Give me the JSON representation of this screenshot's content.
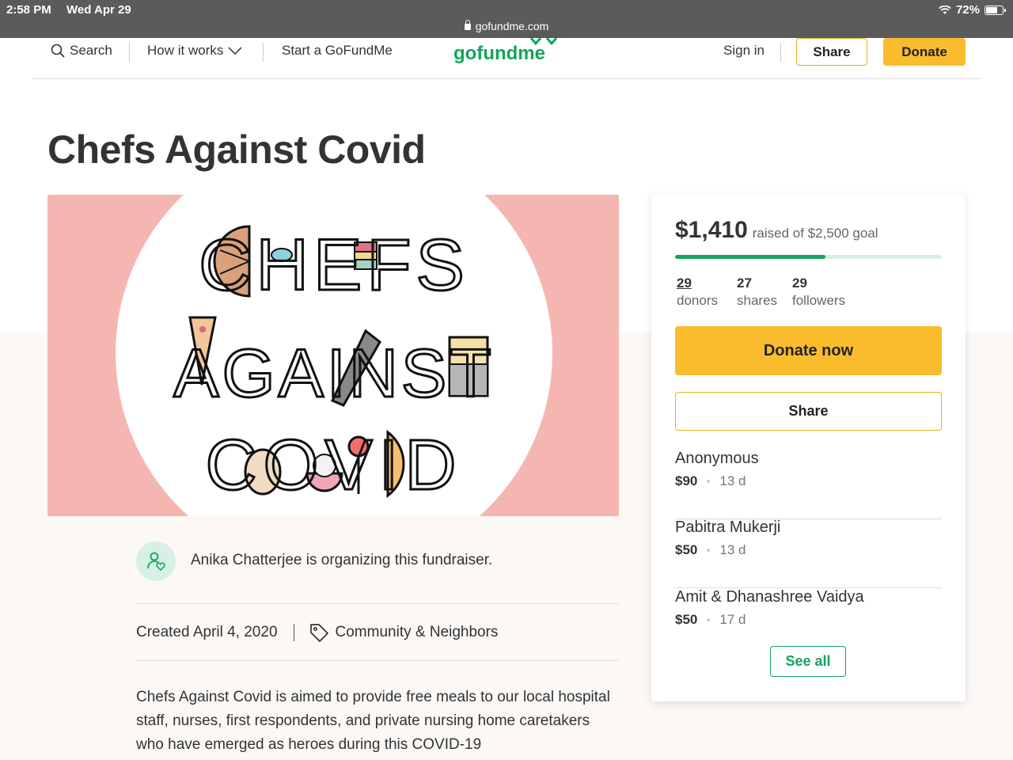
{
  "status_bar": {
    "time": "2:58 PM",
    "date": "Wed Apr 29",
    "url": "gofundme.com",
    "battery": "72%"
  },
  "nav": {
    "search": "Search",
    "how_it_works": "How it works",
    "start": "Start a GoFundMe",
    "logo": "gofundme",
    "sign_in": "Sign in",
    "share": "Share",
    "donate": "Donate"
  },
  "campaign": {
    "title": "Chefs Against Covid",
    "hero_text": [
      "CHEFS",
      "AGAINST",
      "COVID"
    ],
    "organizer": "Anika Chatterjee is organizing this fundraiser.",
    "created": "Created April 4, 2020",
    "category": "Community & Neighbors",
    "story": "Chefs Against Covid is aimed to provide free meals to our local hospital staff, nurses, first respondents, and private nursing home caretakers who have emerged as heroes during this COVID-19"
  },
  "card": {
    "raised_amount": "$1,410",
    "raised_label": "raised of $2,500 goal",
    "progress": 0.564,
    "stats": [
      {
        "num": "29",
        "label": "donors"
      },
      {
        "num": "27",
        "label": "shares"
      },
      {
        "num": "29",
        "label": "followers"
      }
    ],
    "donate_now": "Donate now",
    "share": "Share",
    "donors": [
      {
        "name": "Anonymous",
        "amount": "$90",
        "age": "13 d"
      },
      {
        "name": "Pabitra Mukerji",
        "amount": "$50",
        "age": "13 d"
      },
      {
        "name": "Amit & Dhanashree Vaidya",
        "amount": "$50",
        "age": "17 d"
      }
    ],
    "see_all": "See all"
  },
  "colors": {
    "brand_green": "#12a55c",
    "donate_yellow": "#f9bc2c",
    "hero_pink": "#f5b6b1"
  }
}
